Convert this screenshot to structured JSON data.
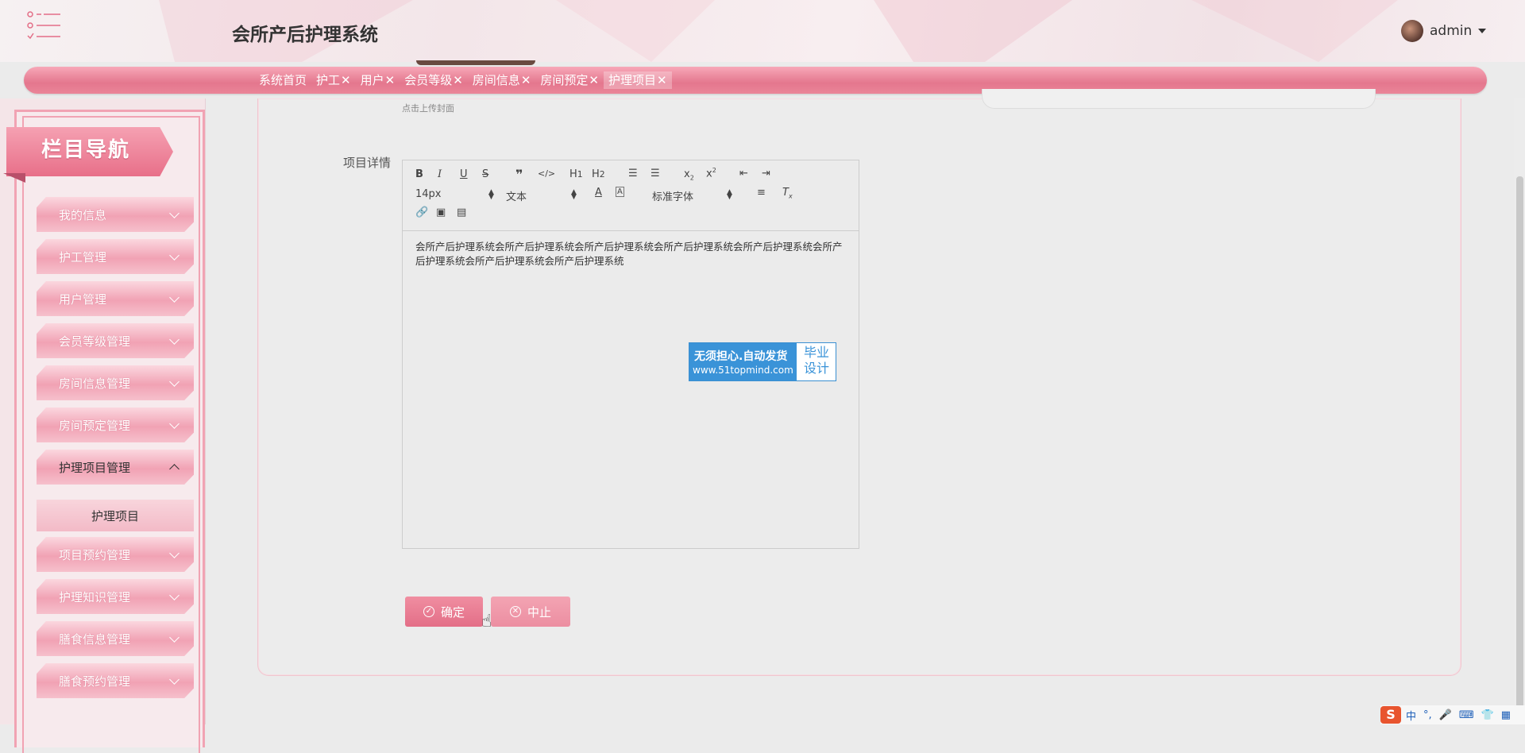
{
  "header": {
    "app_title": "会所产后护理系统",
    "user_name": "admin"
  },
  "tabs": [
    {
      "label": "系统首页",
      "closable": false
    },
    {
      "label": "护工",
      "closable": true
    },
    {
      "label": "用户",
      "closable": true
    },
    {
      "label": "会员等级",
      "closable": true
    },
    {
      "label": "房间信息",
      "closable": true
    },
    {
      "label": "房间预定",
      "closable": true
    },
    {
      "label": "护理项目",
      "closable": true,
      "active": true
    }
  ],
  "tab_close_glyph": "✕",
  "sidebar": {
    "banner": "栏目导航",
    "items": [
      {
        "label": "我的信息"
      },
      {
        "label": "护工管理"
      },
      {
        "label": "用户管理"
      },
      {
        "label": "会员等级管理"
      },
      {
        "label": "房间信息管理"
      },
      {
        "label": "房间预定管理"
      },
      {
        "label": "护理项目管理",
        "expanded": true
      },
      {
        "label": "项目预约管理"
      },
      {
        "label": "护理知识管理"
      },
      {
        "label": "膳食信息管理"
      },
      {
        "label": "膳食预约管理"
      }
    ],
    "sub_item": "护理项目"
  },
  "form": {
    "upload_hint": "点击上传封面",
    "detail_label": "项目详情",
    "editor": {
      "font_size": "14px",
      "block_type": "文本",
      "font_family": "标准字体",
      "content": "会所产后护理系统会所产后护理系统会所产后护理系统会所产后护理系统会所产后护理系统会所产后护理系统会所产后护理系统会所产后护理系统"
    },
    "confirm_label": "确定",
    "cancel_label": "中止"
  },
  "watermark": {
    "line1": "无须担心.自动发货",
    "line2": "www.51topmind.com",
    "right_1": "毕业",
    "right_2": "设计"
  },
  "ime": {
    "logo": "S",
    "lang": "中",
    "punct": "°,"
  },
  "colors": {
    "accent_pink": "#e4778e",
    "light_pink": "#f7a8b8"
  }
}
